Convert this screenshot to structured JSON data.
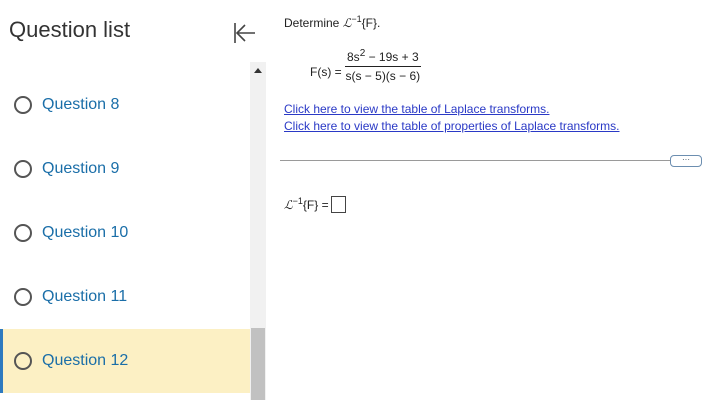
{
  "sidebar": {
    "title": "Question list",
    "items": [
      {
        "label": "Question 8"
      },
      {
        "label": "Question 9"
      },
      {
        "label": "Question 10"
      },
      {
        "label": "Question 11"
      },
      {
        "label": "Question 12",
        "selected": true
      }
    ]
  },
  "main": {
    "prompt_prefix": "Determine ",
    "laplace_symbol": "ℒ",
    "inverse_exp": "−1",
    "prompt_suffix": "{F}.",
    "f_label": "F(s) =",
    "numerator_a": "8s",
    "numerator_exp": "2",
    "numerator_b": " − 19s + 3",
    "denominator": "s(s − 5)(s − 6)",
    "link1": "Click here to view the table of Laplace transforms.",
    "link2": "Click here to view the table of properties of Laplace transforms.",
    "more_label": "···",
    "answer_suffix": "{F} ="
  },
  "colors": {
    "accent": "#2f7abf",
    "selected_bg": "#fcf0c4",
    "link": "#2a39c6",
    "question_text": "#1a6ea8"
  }
}
